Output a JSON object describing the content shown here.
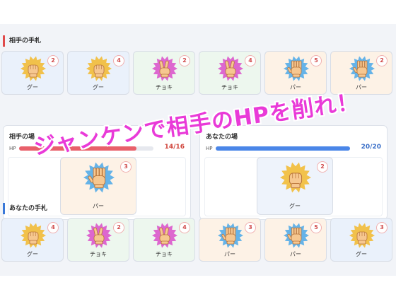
{
  "opponent_hand": {
    "title": "相手の手札",
    "cards": [
      {
        "label": "グー",
        "value": "2",
        "hand": "rock",
        "bg": "blue"
      },
      {
        "label": "グー",
        "value": "4",
        "hand": "rock",
        "bg": "blue"
      },
      {
        "label": "チョキ",
        "value": "2",
        "hand": "scissors",
        "bg": "green"
      },
      {
        "label": "チョキ",
        "value": "4",
        "hand": "scissors",
        "bg": "green"
      },
      {
        "label": "パー",
        "value": "5",
        "hand": "paper",
        "bg": "peach"
      },
      {
        "label": "パー",
        "value": "2",
        "hand": "paper",
        "bg": "peach"
      }
    ]
  },
  "opponent_field": {
    "title": "相手の場",
    "hp_label": "HP",
    "hp_text": "14/16",
    "hp_fraction": 0.875,
    "hp_color": "#e8606a",
    "played": {
      "label": "パー",
      "value": "3",
      "hand": "paper"
    }
  },
  "player_field": {
    "title": "あなたの場",
    "hp_label": "HP",
    "hp_text": "20/20",
    "hp_fraction": 1.0,
    "hp_color": "#4a86e8",
    "played": {
      "label": "グー",
      "value": "2",
      "hand": "rock"
    }
  },
  "player_hand": {
    "title": "あなたの手札",
    "cards": [
      {
        "label": "グー",
        "value": "4",
        "hand": "rock",
        "bg": "blue"
      },
      {
        "label": "チョキ",
        "value": "2",
        "hand": "scissors",
        "bg": "green"
      },
      {
        "label": "チョキ",
        "value": "4",
        "hand": "scissors",
        "bg": "green"
      },
      {
        "label": "パー",
        "value": "3",
        "hand": "paper",
        "bg": "peach"
      },
      {
        "label": "パー",
        "value": "5",
        "hand": "paper",
        "bg": "peach"
      },
      {
        "label": "グー",
        "value": "3",
        "hand": "rock",
        "bg": "blue"
      }
    ]
  },
  "banner": {
    "text": "ジャンケンで相手のHPを削れ！"
  },
  "colors": {
    "rock_burst": "#f2b92b",
    "scissors_burst": "#d94ec9",
    "paper_burst": "#4aa8e8",
    "banner": "#e93ad8"
  }
}
